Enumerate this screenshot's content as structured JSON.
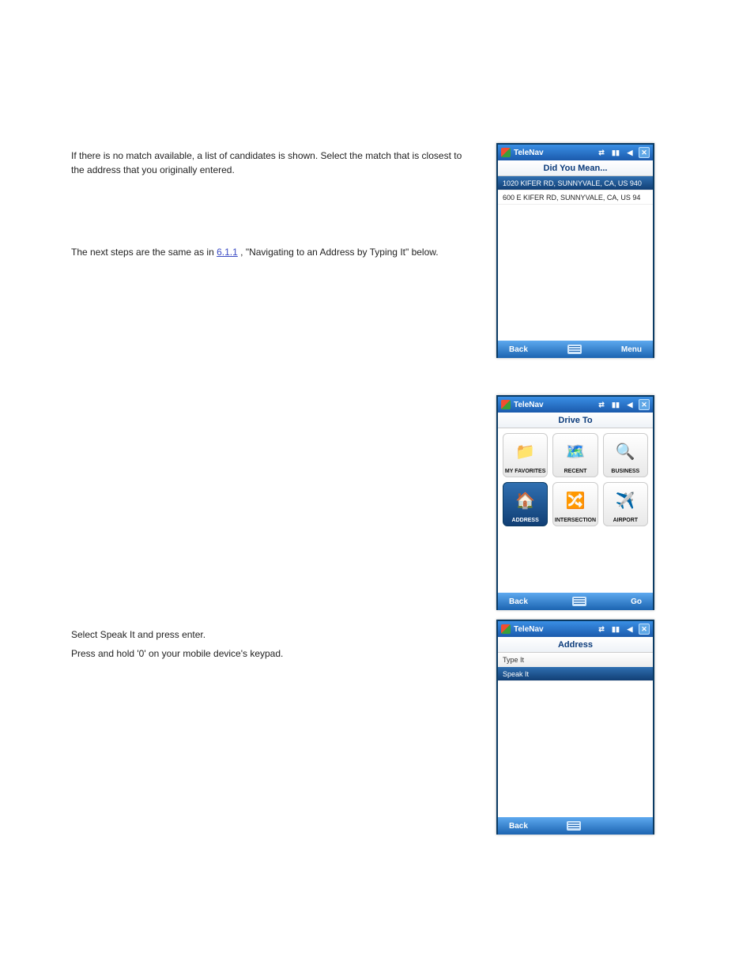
{
  "doc": {
    "para1": "If there is no match available, a list of candidates is shown. Select the match that is closest to the address that you originally entered.",
    "para2_prefix": "The next steps are the same as in ",
    "para2_link": "6.1.1",
    "para2_suffix": ", \"Navigating to an Address by Typing It\" below.",
    "para3": "Select Speak It and press enter.",
    "para4": "Press and hold '0' on your mobile device's keypad."
  },
  "dev1": {
    "app": "TeleNav",
    "title": "Did You Mean...",
    "items": [
      "1020 KIFER RD, SUNNYVALE, CA, US 940",
      "600 E KIFER RD, SUNNYVALE, CA, US 94"
    ],
    "back": "Back",
    "menu": "Menu"
  },
  "dev2": {
    "app": "TeleNav",
    "title": "Drive To",
    "tiles": [
      {
        "label": "MY FAVORITES"
      },
      {
        "label": "RECENT"
      },
      {
        "label": "BUSINESS"
      },
      {
        "label": "ADDRESS"
      },
      {
        "label": "INTERSECTION"
      },
      {
        "label": "AIRPORT"
      }
    ],
    "back": "Back",
    "go": "Go"
  },
  "dev3": {
    "app": "TeleNav",
    "title": "Address",
    "items": [
      "Type It",
      "Speak It"
    ],
    "back": "Back"
  },
  "icons": {
    "fav": "📁",
    "recent": "🗺️",
    "business": "🔍",
    "address": "🏠",
    "intersection": "🔀",
    "airport": "✈️"
  }
}
